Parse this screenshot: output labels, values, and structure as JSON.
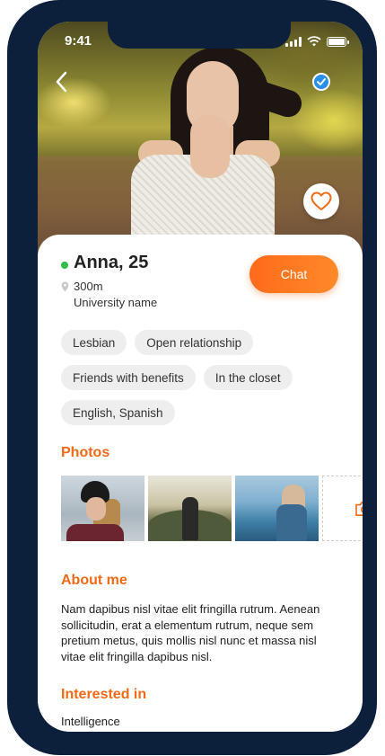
{
  "status_bar": {
    "time": "9:41"
  },
  "profile": {
    "name_age": "Anna, 25",
    "distance": "300m",
    "university": "University name",
    "chat_label": "Chat",
    "online_color": "#2fbd4b"
  },
  "tags": [
    [
      "Lesbian",
      "Open relationship"
    ],
    [
      "Friends with benefits",
      "In the closet"
    ],
    [
      "English, Spanish"
    ]
  ],
  "sections": {
    "photos": "Photos",
    "about": "About me",
    "interested": "Interested in"
  },
  "about_text": "Nam dapibus nisl vitae elit fringilla rutrum. Aenean sollicitudin, erat a elementum rutrum, neque sem pretium metus, quis mollis nisl nunc et massa nisl vitae elit fringilla dapibus nisl.",
  "interested_in": [
    "Intelligence"
  ],
  "icons": {
    "back": "chevron-left-icon",
    "verified": "verified-check-icon",
    "like": "heart-icon",
    "location": "location-pin-icon",
    "add_photo": "camera-icon"
  },
  "colors": {
    "accent": "#f06a18",
    "chat_button": "#ff7a22",
    "frame": "#0c1f3b",
    "verified": "#2a8fe8",
    "tag_bg": "#eeeeee"
  }
}
